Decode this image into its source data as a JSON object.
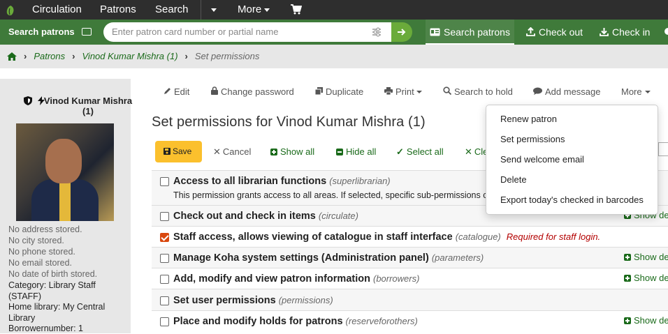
{
  "topnav": {
    "logo_icon": "koha-leaf-icon",
    "items": [
      "Circulation",
      "Patrons",
      "Search"
    ],
    "more_label": "More",
    "cart_icon": "cart-icon"
  },
  "searchbar": {
    "label": "Search patrons",
    "placeholder": "Enter patron card number or partial name",
    "actions": [
      "Search patrons",
      "Check out",
      "Check in"
    ]
  },
  "breadcrumb": {
    "items": [
      "Patrons",
      "Vinod Kumar Mishra (1)"
    ],
    "current": "Set permissions"
  },
  "patron": {
    "name": "Vinod Kumar Mishra (1)",
    "info_lines": [
      "No address stored.",
      "No city stored.",
      "No phone stored.",
      "No email stored.",
      "No date of birth stored."
    ],
    "category": "Category: Library Staff (STAFF)",
    "home_library": "Home library: My Central Library",
    "borrowernumber": "Borrowernumber: 1"
  },
  "toolbar": {
    "items": [
      "Edit",
      "Change password",
      "Duplicate",
      "Print",
      "Search to hold",
      "Add message",
      "More"
    ]
  },
  "page": {
    "title": "Set permissions for Vinod Kumar Mishra (1)"
  },
  "actions": {
    "save": "Save",
    "cancel": "Cancel",
    "show_all": "Show all",
    "hide_all": "Hide all",
    "select_all": "Select all",
    "clear_all": "Cle"
  },
  "permissions": [
    {
      "title": "Access to all librarian functions",
      "code": "(superlibrarian)",
      "checked": false,
      "desc": "This permission grants access to all areas. If selected, specific sub-permissions ca",
      "show_details": ""
    },
    {
      "title": "Check out and check in items",
      "code": "(circulate)",
      "checked": false,
      "desc": "",
      "show_details": "Show de"
    },
    {
      "title": "Staff access, allows viewing of catalogue in staff interface",
      "code": "(catalogue)",
      "checked": true,
      "required": "Required for staff login.",
      "desc": "",
      "show_details": ""
    },
    {
      "title": "Manage Koha system settings (Administration panel)",
      "code": "(parameters)",
      "checked": false,
      "desc": "",
      "show_details": "Show de"
    },
    {
      "title": "Add, modify and view patron information",
      "code": "(borrowers)",
      "checked": false,
      "desc": "",
      "show_details": "Show de"
    },
    {
      "title": "Set user permissions",
      "code": "(permissions)",
      "checked": false,
      "desc": "",
      "show_details": ""
    },
    {
      "title": "Place and modify holds for patrons",
      "code": "(reserveforothers)",
      "checked": false,
      "desc": "",
      "show_details": "Show de"
    }
  ],
  "more_menu": {
    "items": [
      "Renew patron",
      "Set permissions",
      "Send welcome email",
      "Delete",
      "Export today's checked in barcodes"
    ]
  },
  "colors": {
    "topbar": "#2e2e2e",
    "searchbar": "#3f7a3a",
    "accent_green": "#1a6a1a",
    "save_button": "#fbc02d",
    "checkbox_checked": "#d9480f",
    "required_text": "#b30000"
  }
}
